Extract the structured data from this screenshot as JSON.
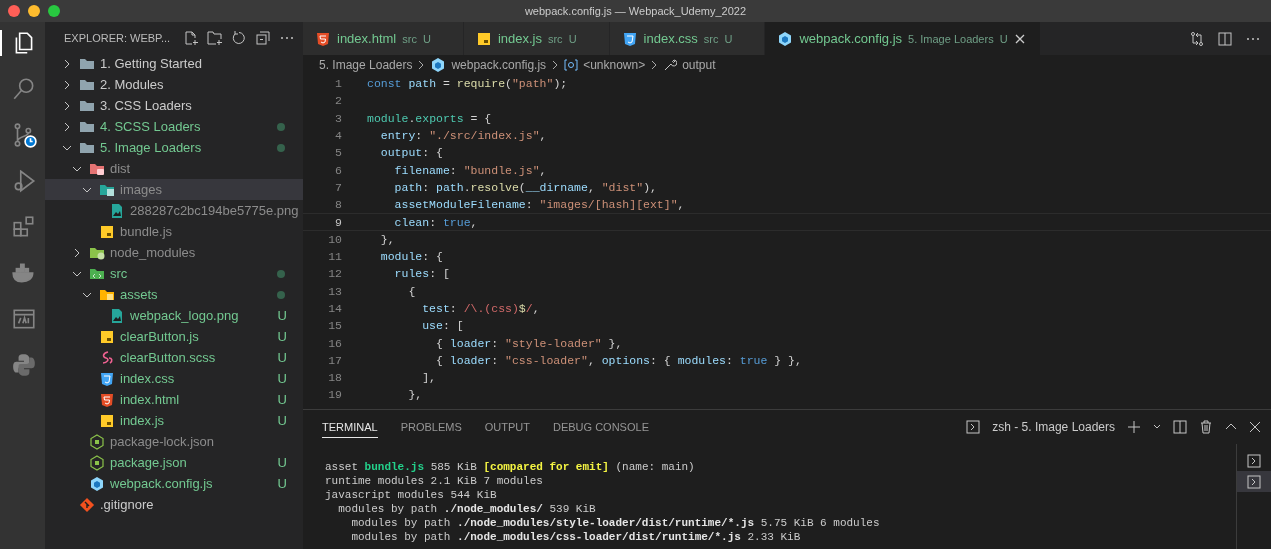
{
  "window": {
    "title": "webpack.config.js — Webpack_Udemy_2022"
  },
  "activity_bar": [
    {
      "kind": "files",
      "selected": true
    },
    {
      "kind": "search",
      "selected": false
    },
    {
      "kind": "scm",
      "selected": false
    },
    {
      "kind": "debug",
      "selected": false
    },
    {
      "kind": "extensions",
      "selected": false
    },
    {
      "kind": "docker",
      "selected": false
    },
    {
      "kind": "api",
      "selected": false
    },
    {
      "kind": "python",
      "selected": false
    }
  ],
  "sidebar": {
    "title": "EXPLORER: WEBP...",
    "items": [
      {
        "name": "1. Getting Started",
        "kind": "folder",
        "expanded": false,
        "color": "#cccccc",
        "dot": false,
        "selected": false
      },
      {
        "name": "2. Modules",
        "kind": "folder",
        "expanded": false,
        "color": "#cccccc",
        "dot": false,
        "selected": false
      },
      {
        "name": "3. CSS Loaders",
        "kind": "folder",
        "expanded": false,
        "color": "#cccccc",
        "dot": false,
        "selected": false
      },
      {
        "name": "4. SCSS Loaders",
        "kind": "folder",
        "expanded": false,
        "color": "#73c991",
        "dot": true,
        "selected": false
      },
      {
        "name": "5. Image Loaders",
        "kind": "folder",
        "expanded": true,
        "color": "#73c991",
        "dot": true,
        "selected": false,
        "children": [
          {
            "name": "dist",
            "kind": "folder-dist",
            "expanded": true,
            "color": "#8c8c8c",
            "dot": false,
            "selected": false,
            "children": [
              {
                "name": "images",
                "kind": "folder-images",
                "expanded": true,
                "color": "#8c8c8c",
                "dot": false,
                "selected": true,
                "children": [
                  {
                    "name": "288287c2bc194be5775e.png",
                    "kind": "image",
                    "color": "#8c8c8c",
                    "dot": false,
                    "selected": false
                  }
                ]
              },
              {
                "name": "bundle.js",
                "kind": "js",
                "color": "#8c8c8c",
                "dot": false,
                "selected": false
              }
            ]
          },
          {
            "name": "node_modules",
            "kind": "folder-node",
            "expanded": false,
            "color": "#8c8c8c",
            "dot": false,
            "selected": false
          },
          {
            "name": "src",
            "kind": "folder-src",
            "expanded": true,
            "color": "#73c991",
            "dot": true,
            "selected": false,
            "children": [
              {
                "name": "assets",
                "kind": "folder-assets",
                "expanded": true,
                "color": "#73c991",
                "dot": true,
                "selected": false,
                "children": [
                  {
                    "name": "webpack_logo.png",
                    "kind": "image",
                    "color": "#73c991",
                    "badge": "U",
                    "dot": false,
                    "selected": false
                  }
                ]
              },
              {
                "name": "clearButton.js",
                "kind": "js",
                "color": "#73c991",
                "badge": "U",
                "dot": false,
                "selected": false
              },
              {
                "name": "clearButton.scss",
                "kind": "scss",
                "color": "#73c991",
                "badge": "U",
                "dot": false,
                "selected": false
              },
              {
                "name": "index.css",
                "kind": "css",
                "color": "#73c991",
                "badge": "U",
                "dot": false,
                "selected": false
              },
              {
                "name": "index.html",
                "kind": "html",
                "color": "#73c991",
                "badge": "U",
                "dot": false,
                "selected": false
              },
              {
                "name": "index.js",
                "kind": "js",
                "color": "#73c991",
                "badge": "U",
                "dot": false,
                "selected": false
              }
            ]
          },
          {
            "name": "package-lock.json",
            "kind": "json",
            "color": "#8c8c8c",
            "dot": false,
            "selected": false
          },
          {
            "name": "package.json",
            "kind": "json",
            "color": "#73c991",
            "badge": "U",
            "dot": false,
            "selected": false
          },
          {
            "name": "webpack.config.js",
            "kind": "webpack",
            "color": "#73c991",
            "badge": "U",
            "dot": false,
            "selected": false
          }
        ]
      },
      {
        "name": ".gitignore",
        "kind": "git",
        "color": "#cccccc",
        "dot": false,
        "selected": false
      }
    ]
  },
  "tabs": [
    {
      "label": "index.html",
      "kind": "html",
      "description": "src",
      "badge": "U",
      "selected": false
    },
    {
      "label": "index.js",
      "kind": "js",
      "description": "src",
      "badge": "U",
      "selected": false
    },
    {
      "label": "index.css",
      "kind": "css",
      "description": "src",
      "badge": "U",
      "selected": false
    },
    {
      "label": "webpack.config.js",
      "kind": "webpack",
      "description": "5. Image Loaders",
      "badge": "U",
      "selected": true
    }
  ],
  "breadcrumb": [
    {
      "label": "5. Image Loaders",
      "kind": "folder"
    },
    {
      "label": "webpack.config.js",
      "kind": "webpack"
    },
    {
      "label": "<unknown>",
      "kind": "symbol"
    },
    {
      "label": "output",
      "kind": "property"
    }
  ],
  "code": [
    {
      "number": "1",
      "current": false,
      "tokens": [
        {
          "kind": "kw",
          "text": "const "
        },
        {
          "kind": "var",
          "text": "path"
        },
        {
          "kind": "punct",
          "text": " = "
        },
        {
          "kind": "fn",
          "text": "require"
        },
        {
          "kind": "punct",
          "text": "("
        },
        {
          "kind": "str",
          "text": "\"path\""
        },
        {
          "kind": "punct",
          "text": ");"
        }
      ]
    },
    {
      "number": "2",
      "current": false
    },
    {
      "number": "3",
      "current": false,
      "tokens": [
        {
          "kind": "type",
          "text": "module"
        },
        {
          "kind": "punct",
          "text": "."
        },
        {
          "kind": "type",
          "text": "exports"
        },
        {
          "kind": "punct",
          "text": " = {"
        }
      ]
    },
    {
      "number": "4",
      "current": false,
      "tokens": [
        {
          "kind": "prop",
          "text": "  entry"
        },
        {
          "kind": "punct",
          "text": ": "
        },
        {
          "kind": "str",
          "text": "\"./src/index.js\""
        },
        {
          "kind": "punct",
          "text": ","
        }
      ]
    },
    {
      "number": "5",
      "current": false,
      "tokens": [
        {
          "kind": "prop",
          "text": "  output"
        },
        {
          "kind": "punct",
          "text": ": {"
        }
      ]
    },
    {
      "number": "6",
      "current": false,
      "tokens": [
        {
          "kind": "prop",
          "text": "    filename"
        },
        {
          "kind": "punct",
          "text": ": "
        },
        {
          "kind": "str",
          "text": "\"bundle.js\""
        },
        {
          "kind": "punct",
          "text": ","
        }
      ]
    },
    {
      "number": "7",
      "current": false,
      "tokens": [
        {
          "kind": "prop",
          "text": "    path"
        },
        {
          "kind": "punct",
          "text": ": "
        },
        {
          "kind": "var",
          "text": "path"
        },
        {
          "kind": "punct",
          "text": "."
        },
        {
          "kind": "fn",
          "text": "resolve"
        },
        {
          "kind": "punct",
          "text": "("
        },
        {
          "kind": "var",
          "text": "__dirname"
        },
        {
          "kind": "punct",
          "text": ", "
        },
        {
          "kind": "str",
          "text": "\"dist\""
        },
        {
          "kind": "punct",
          "text": "),"
        }
      ]
    },
    {
      "number": "8",
      "current": false,
      "tokens": [
        {
          "kind": "prop",
          "text": "    assetModuleFilename"
        },
        {
          "kind": "punct",
          "text": ": "
        },
        {
          "kind": "str",
          "text": "\"images/[hash][ext]\""
        },
        {
          "kind": "punct",
          "text": ","
        }
      ]
    },
    {
      "number": "9",
      "current": true,
      "tokens": [
        {
          "kind": "prop",
          "text": "    clean"
        },
        {
          "kind": "punct",
          "text": ": "
        },
        {
          "kind": "kw",
          "text": "true"
        },
        {
          "kind": "punct",
          "text": ","
        }
      ]
    },
    {
      "number": "10",
      "current": false,
      "tokens": [
        {
          "kind": "punct",
          "text": "  },"
        }
      ]
    },
    {
      "number": "11",
      "current": false,
      "tokens": [
        {
          "kind": "prop",
          "text": "  module"
        },
        {
          "kind": "punct",
          "text": ": {"
        }
      ]
    },
    {
      "number": "12",
      "current": false,
      "tokens": [
        {
          "kind": "prop",
          "text": "    rules"
        },
        {
          "kind": "punct",
          "text": ": ["
        }
      ]
    },
    {
      "number": "13",
      "current": false,
      "tokens": [
        {
          "kind": "punct",
          "text": "      {"
        }
      ]
    },
    {
      "number": "14",
      "current": false,
      "tokens": [
        {
          "kind": "prop",
          "text": "        test"
        },
        {
          "kind": "punct",
          "text": ": "
        },
        {
          "kind": "regex",
          "text": "/\\.(css)"
        },
        {
          "kind": "fn",
          "text": "$"
        },
        {
          "kind": "regex",
          "text": "/"
        },
        {
          "kind": "punct",
          "text": ","
        }
      ]
    },
    {
      "number": "15",
      "current": false,
      "tokens": [
        {
          "kind": "prop",
          "text": "        use"
        },
        {
          "kind": "punct",
          "text": ": ["
        }
      ]
    },
    {
      "number": "16",
      "current": false,
      "tokens": [
        {
          "kind": "punct",
          "text": "          { "
        },
        {
          "kind": "prop",
          "text": "loader"
        },
        {
          "kind": "punct",
          "text": ": "
        },
        {
          "kind": "str",
          "text": "\"style-loader\""
        },
        {
          "kind": "punct",
          "text": " },"
        }
      ]
    },
    {
      "number": "17",
      "current": false,
      "tokens": [
        {
          "kind": "punct",
          "text": "          { "
        },
        {
          "kind": "prop",
          "text": "loader"
        },
        {
          "kind": "punct",
          "text": ": "
        },
        {
          "kind": "str",
          "text": "\"css-loader\""
        },
        {
          "kind": "punct",
          "text": ", "
        },
        {
          "kind": "prop",
          "text": "options"
        },
        {
          "kind": "punct",
          "text": ": { "
        },
        {
          "kind": "prop",
          "text": "modules"
        },
        {
          "kind": "punct",
          "text": ": "
        },
        {
          "kind": "kw",
          "text": "true"
        },
        {
          "kind": "punct",
          "text": " } },"
        }
      ]
    },
    {
      "number": "18",
      "current": false,
      "tokens": [
        {
          "kind": "punct",
          "text": "        ],"
        }
      ]
    },
    {
      "number": "19",
      "current": false,
      "tokens": [
        {
          "kind": "punct",
          "text": "      },"
        }
      ]
    }
  ],
  "panel": {
    "tabs": [
      {
        "label": "TERMINAL",
        "selected": true
      },
      {
        "label": "PROBLEMS",
        "selected": false
      },
      {
        "label": "OUTPUT",
        "selected": false
      },
      {
        "label": "DEBUG CONSOLE",
        "selected": false
      }
    ],
    "terminal_name": "zsh - 5. Image Loaders",
    "terminal_list": [
      {
        "selected": false
      },
      {
        "selected": true
      }
    ],
    "lines": [
      [
        {
          "kind": "plain",
          "text": "asset "
        },
        {
          "kind": "green",
          "text": "bundle.js"
        },
        {
          "kind": "plain",
          "text": " 585 KiB "
        },
        {
          "kind": "yellow",
          "text": "[compared for emit]"
        },
        {
          "kind": "plain",
          "text": " (name: main)"
        }
      ],
      [
        {
          "kind": "plain",
          "text": "runtime modules 2.1 KiB 7 modules"
        }
      ],
      [
        {
          "kind": "plain",
          "text": "javascript modules 544 KiB"
        }
      ],
      [
        {
          "kind": "plain",
          "text": "  modules by path "
        },
        {
          "kind": "bold",
          "text": "./node_modules/"
        },
        {
          "kind": "plain",
          "text": " 539 KiB"
        }
      ],
      [
        {
          "kind": "plain",
          "text": "    modules by path "
        },
        {
          "kind": "bold",
          "text": "./node_modules/style-loader/dist/runtime/*.js"
        },
        {
          "kind": "plain",
          "text": " 5.75 KiB 6 modules"
        }
      ],
      [
        {
          "kind": "plain",
          "text": "    modules by path "
        },
        {
          "kind": "bold",
          "text": "./node_modules/css-loader/dist/runtime/*.js"
        },
        {
          "kind": "plain",
          "text": " 2.33 KiB"
        }
      ]
    ]
  }
}
